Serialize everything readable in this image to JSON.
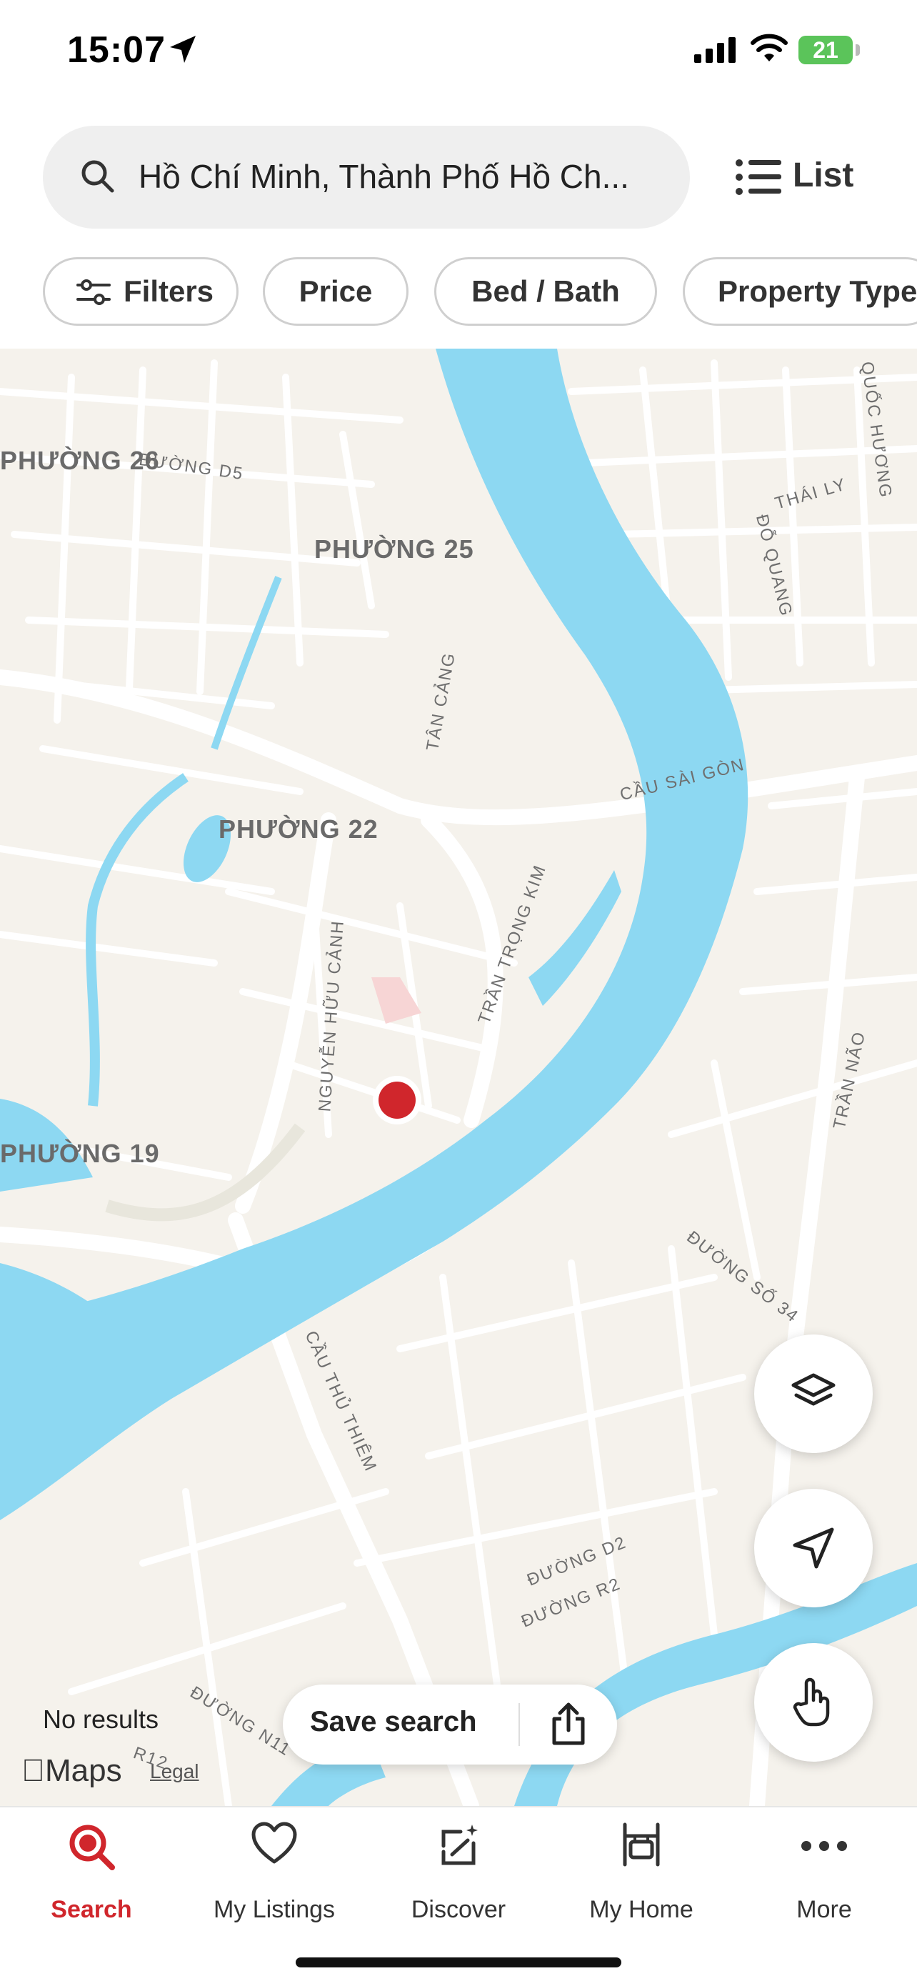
{
  "status_bar": {
    "time": "15:07",
    "battery": "21"
  },
  "search": {
    "query": "Hồ Chí Minh, Thành Phố Hồ Ch..."
  },
  "list_button": {
    "label": "List"
  },
  "filters": [
    {
      "label": "Filters"
    },
    {
      "label": "Price"
    },
    {
      "label": "Bed / Bath"
    },
    {
      "label": "Property Type"
    }
  ],
  "map": {
    "districts": [
      "PHƯỜNG 26",
      "PHƯỜNG 25",
      "PHƯỜNG 22",
      "PHƯỜNG 19"
    ],
    "streets": [
      "ĐƯỜNG D5",
      "TÂN CẢNG",
      "CẦU SÀI GÒN",
      "TRẦN TRỌNG KIM",
      "NGUYỄN HỮU CẢNH",
      "CẦU THỦ THIÊM",
      "TRẦN NÃO",
      "ĐƯỜNG SỐ 34",
      "ĐƯỜNG D2",
      "ĐƯỜNG R2",
      "ĐƯỜNG N11",
      "R12",
      "THÁI LY",
      "ĐỖ QUANG",
      "QUỐC HƯƠNG"
    ],
    "results_text": "No results",
    "attribution": "Maps",
    "legal": "Legal"
  },
  "save_search": {
    "label": "Save search"
  },
  "tabs": [
    {
      "label": "Search",
      "icon": "search-icon",
      "active": true
    },
    {
      "label": "My Listings",
      "icon": "heart-icon"
    },
    {
      "label": "Discover",
      "icon": "discover-icon"
    },
    {
      "label": "My Home",
      "icon": "home-icon"
    },
    {
      "label": "More",
      "icon": "more-icon"
    }
  ],
  "colors": {
    "accent": "#d0262c",
    "water": "#8dd8f2",
    "land": "#f5f2ec",
    "road": "#ffffff",
    "battery": "#5bc45a"
  }
}
